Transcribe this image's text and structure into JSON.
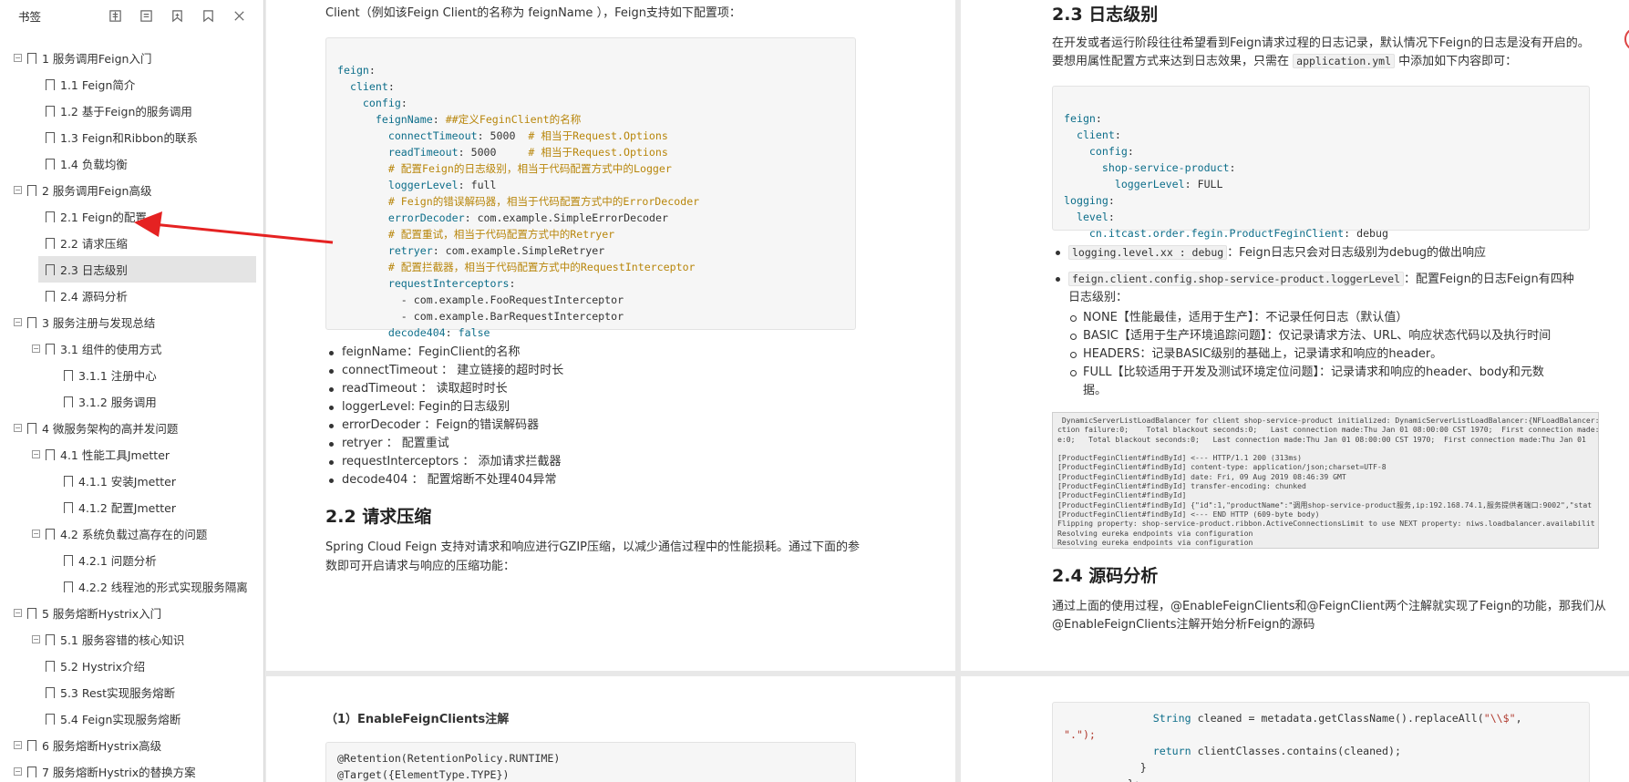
{
  "sidebar": {
    "title": "书签",
    "items": [
      {
        "label": "1 服务调用Feign入门",
        "expander": "⊟"
      },
      {
        "label": "1.1 Feign简介",
        "expander": ""
      },
      {
        "label": "1.2 基于Feign的服务调用",
        "expander": ""
      },
      {
        "label": "1.3 Feign和Ribbon的联系",
        "expander": ""
      },
      {
        "label": "1.4 负载均衡",
        "expander": ""
      },
      {
        "label": "2 服务调用Feign高级",
        "expander": "⊟"
      },
      {
        "label": "2.1 Feign的配置",
        "expander": ""
      },
      {
        "label": "2.2 请求压缩",
        "expander": ""
      },
      {
        "label": "2.3 日志级别",
        "expander": ""
      },
      {
        "label": "2.4 源码分析",
        "expander": ""
      },
      {
        "label": "3 服务注册与发现总结",
        "expander": "⊟"
      },
      {
        "label": "3.1 组件的使用方式",
        "expander": "⊟"
      },
      {
        "label": "3.1.1 注册中心",
        "expander": ""
      },
      {
        "label": "3.1.2 服务调用",
        "expander": ""
      },
      {
        "label": "4 微服务架构的高并发问题",
        "expander": "⊟"
      },
      {
        "label": "4.1 性能工具Jmetter",
        "expander": "⊟"
      },
      {
        "label": "4.1.1 安装Jmetter",
        "expander": ""
      },
      {
        "label": "4.1.2 配置Jmetter",
        "expander": ""
      },
      {
        "label": "4.2 系统负载过高存在的问题",
        "expander": "⊟"
      },
      {
        "label": "4.2.1 问题分析",
        "expander": ""
      },
      {
        "label": "4.2.2 线程池的形式实现服务隔离",
        "expander": ""
      },
      {
        "label": "5 服务熔断Hystrix入门",
        "expander": "⊟"
      },
      {
        "label": "5.1 服务容错的核心知识",
        "expander": "⊟"
      },
      {
        "label": "5.2 Hystrix介绍",
        "expander": ""
      },
      {
        "label": "5.3 Rest实现服务熔断",
        "expander": ""
      },
      {
        "label": "5.4 Feign实现服务熔断",
        "expander": ""
      },
      {
        "label": "6 服务熔断Hystrix高级",
        "expander": "⊟"
      },
      {
        "label": "7 服务熔断Hystrix的替换方案",
        "expander": "⊟"
      }
    ]
  },
  "page_left": {
    "intro": "Client（例如该Feign Client的名称为 feignName ），Feign支持如下配置项：",
    "bullets": [
      "feignName：FeginClient的名称",
      "connectTimeout ： 建立链接的超时时长",
      "readTimeout ： 读取超时时长",
      "loggerLevel: Fegin的日志级别",
      "errorDecoder ：Feign的错误解码器",
      "retryer ： 配置重试",
      "requestInterceptors ： 添加请求拦截器",
      "decode404 ： 配置熔断不处理404异常"
    ],
    "h_22": "2.2 请求压缩",
    "p_22": "Spring Cloud Feign 支持对请求和响应进行GZIP压缩，以减少通信过程中的性能损耗。通过下面的参数即可开启请求与响应的压缩功能："
  },
  "page_left_bottom": {
    "heading": "（1）EnableFeignClients注解",
    "code1": "@Retention(RetentionPolicy.RUNTIME)",
    "code2": "@Target({ElementType.TYPE})"
  },
  "page_right": {
    "h_23": "2.3 日志级别",
    "p_23a": "在开发或者运行阶段往往希望看到Feign请求过程的日志记录，默认情况下Feign的日志是没有开启的。",
    "p_23b": "要想用属性配置方式来达到日志效果，只需在 application.yml 中添加如下内容即可：",
    "b1": "logging.level.xx : debug：Feign日志只会对日志级别为debug的做出响应",
    "b2a": "feign.client.config.shop-service-product.loggerLevel：配置Feign的日志Feign有四种",
    "b2b": "日志级别：",
    "sub": [
      "NONE【性能最佳，适用于生产】：不记录任何日志（默认值）",
      "BASIC【适用于生产环境追踪问题】：仅记录请求方法、URL、响应状态代码以及执行时间",
      "HEADERS：记录BASIC级别的基础上，记录请求和响应的header。",
      "FULL【比较适用于开发及测试环境定位问题】：记录请求和响应的header、body和元数",
      "据。"
    ],
    "log": [
      " DynamicServerListLoadBalancer for client shop-service-product initialized: DynamicServerListLoadBalancer:{NFLoadBalancer:",
      "ction failure:0;    Total blackout seconds:0;   Last connection made:Thu Jan 01 08:00:00 CST 1970;  First connection made:",
      "e:0;   Total blackout seconds:0;   Last connection made:Thu Jan 01 08:00:00 CST 1970;  First connection made:Thu Jan 01",
      "",
      "[ProductFeginClient#findById] <--- HTTP/1.1 200 (313ms)",
      "[ProductFeginClient#findById] content-type: application/json;charset=UTF-8",
      "[ProductFeginClient#findById] date: Fri, 09 Aug 2019 08:46:39 GMT",
      "[ProductFeginClient#findById] transfer-encoding: chunked",
      "[ProductFeginClient#findById]",
      "[ProductFeginClient#findById] {\"id\":1,\"productName\":\"调用shop-service-product服务,ip:192.168.74.1,服务提供者端口:9002\",\"stat",
      "[ProductFeginClient#findById] <--- END HTTP (609-byte body)",
      "Flipping property: shop-service-product.ribbon.ActiveConnectionsLimit to use NEXT property: niws.loadbalancer.availabilit",
      "Resolving eureka endpoints via configuration",
      "Resolving eureka endpoints via configuration"
    ],
    "h_24": "2.4 源码分析",
    "p_24a": "通过上面的使用过程，@EnableFeignClients和@FeignClient两个注解就实现了Feign的功能，那我们从",
    "p_24b": "@EnableFeignClients注解开始分析Feign的源码"
  },
  "page_right_bottom": {
    "line1_kw": "String",
    "line1_rest": " cleaned = metadata.getClassName().replaceAll(",
    "line1_str": "\"\\\\$\"",
    "line1_end": ",",
    "line2": "\".\");",
    "line3_kw": "return",
    "line3_rest": " clientClasses.contains(cleaned);",
    "line4": "}",
    "line5": "};"
  }
}
